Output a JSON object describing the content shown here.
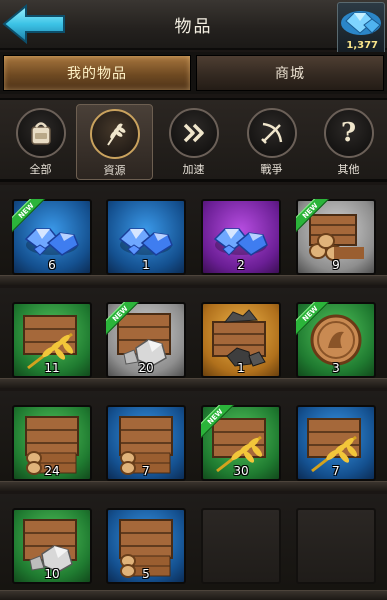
{
  "header": {
    "title": "物品",
    "back_icon": "back-arrow-icon",
    "gem_icon": "gem-icon",
    "gem_count": "1,377"
  },
  "tabs": [
    {
      "label": "我的物品",
      "active": true
    },
    {
      "label": "商城",
      "active": false
    }
  ],
  "categories": [
    {
      "label": "全部",
      "icon": "backpack-icon",
      "active": false
    },
    {
      "label": "資源",
      "icon": "wheat-icon",
      "active": true
    },
    {
      "label": "加速",
      "icon": "fast-forward-icon",
      "active": false
    },
    {
      "label": "戰爭",
      "icon": "crossed-swords-icon",
      "active": false
    },
    {
      "label": "其他",
      "icon": "question-mark-icon",
      "active": false
    }
  ],
  "items": [
    {
      "qty": "6",
      "bg": "blue",
      "art": "gems",
      "new": true
    },
    {
      "qty": "1",
      "bg": "blue",
      "art": "gems",
      "new": false
    },
    {
      "qty": "2",
      "bg": "purple",
      "art": "gems",
      "new": false
    },
    {
      "qty": "9",
      "bg": "gray",
      "art": "wood",
      "new": true
    },
    {
      "qty": "11",
      "bg": "green",
      "art": "crate-wheat",
      "new": false
    },
    {
      "qty": "20",
      "bg": "gray",
      "art": "crate-silver",
      "new": true
    },
    {
      "qty": "1",
      "bg": "gold",
      "art": "crate-ore",
      "new": false
    },
    {
      "qty": "3",
      "bg": "green",
      "art": "coin",
      "new": true
    },
    {
      "qty": "24",
      "bg": "green",
      "art": "crate-wood",
      "new": false
    },
    {
      "qty": "7",
      "bg": "blue",
      "art": "crate-wood",
      "new": false
    },
    {
      "qty": "30",
      "bg": "green",
      "art": "crate-wheat",
      "new": true
    },
    {
      "qty": "7",
      "bg": "blue",
      "art": "crate-wheat",
      "new": false
    },
    {
      "qty": "10",
      "bg": "green",
      "art": "crate-silver",
      "new": false
    },
    {
      "qty": "5",
      "bg": "blue",
      "art": "crate-wood",
      "new": false
    }
  ],
  "new_badge_label": "NEW",
  "colors": {
    "accent_gold": "#c9a25e",
    "badge_green": "#2bb43a",
    "gem_count_color": "#f8e48a"
  }
}
